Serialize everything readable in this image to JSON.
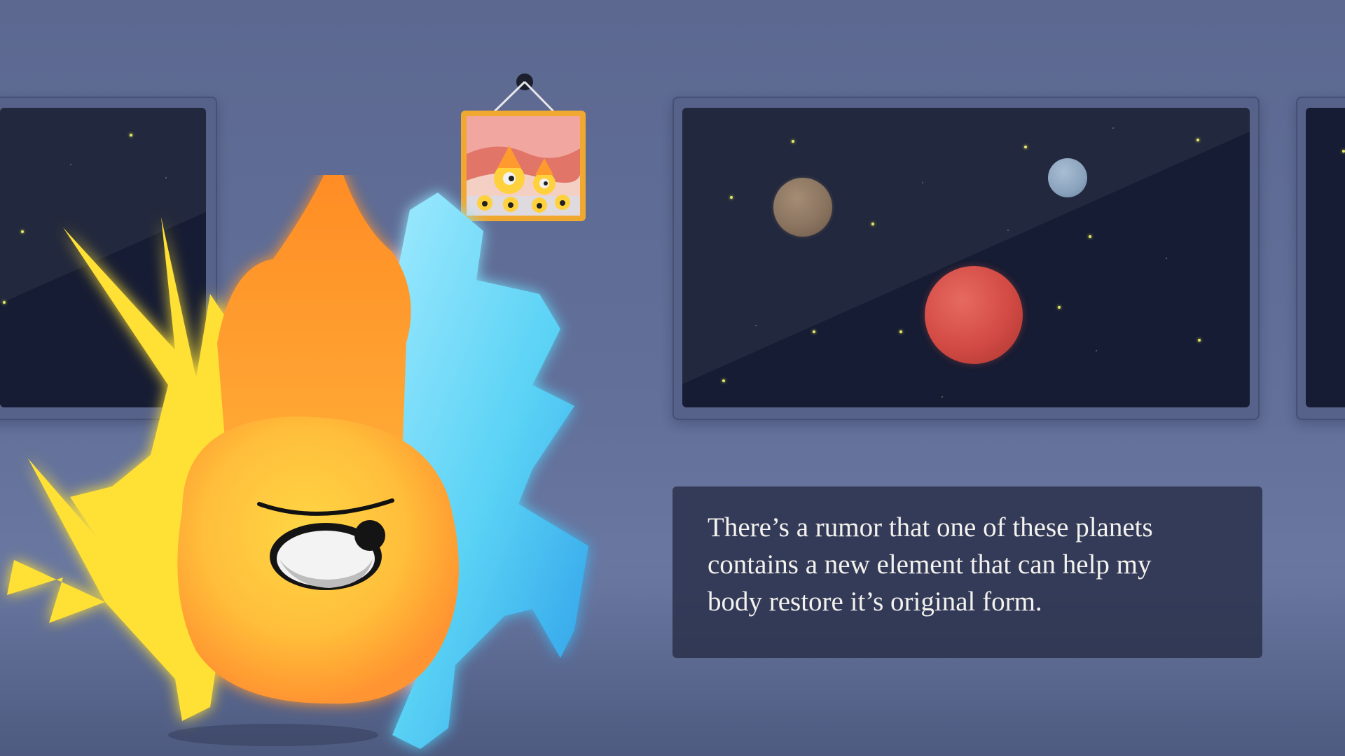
{
  "dialogue": {
    "lines": [
      "There’s  a rumor that one of these planets",
      " contains a new element that can help my",
      " body restore it’s original form."
    ]
  },
  "colors": {
    "wall": "#5c6890",
    "window_glass": "#161c33",
    "dialogue_bg": "#282e48",
    "dialogue_text": "#f4f2ee",
    "fire_yellow": "#ffe135",
    "fire_orange": "#ff9a2e",
    "ice_blue": "#5ad2f5",
    "planet_red": "#d24a44",
    "planet_brown": "#8a7460",
    "planet_blue": "#8aa2bc"
  },
  "icons": {
    "hero": "fire-ice-elemental-character",
    "portrait": "family-portrait-picture-frame",
    "planets": [
      "brown-planet",
      "blue-planet",
      "red-planet"
    ]
  }
}
